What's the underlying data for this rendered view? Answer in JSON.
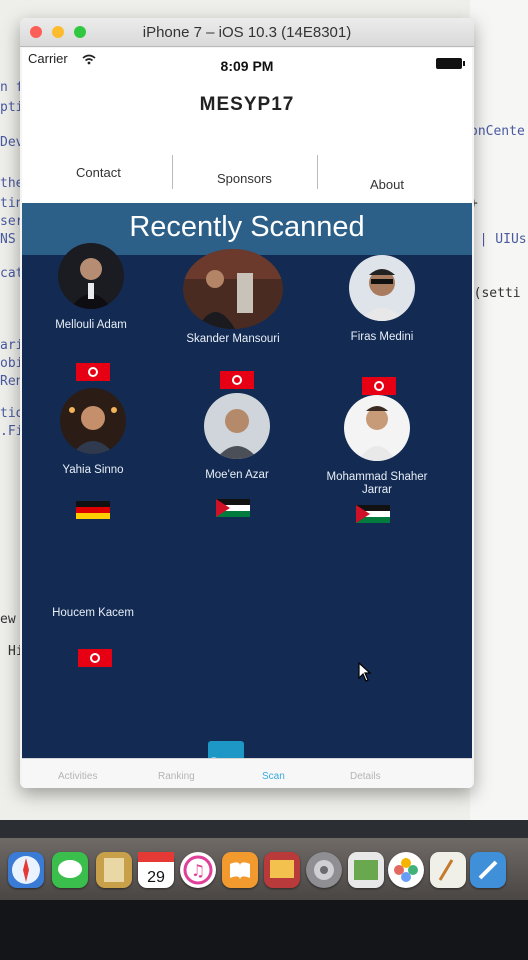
{
  "window": {
    "title": "iPhone 7 – iOS 10.3 (14E8301)"
  },
  "status_bar": {
    "carrier": "Carrier",
    "time": "8:09 PM"
  },
  "nav": {
    "title": "MESYP17"
  },
  "segments": [
    {
      "label": "Contact"
    },
    {
      "label": "Sponsors"
    },
    {
      "label": "About"
    }
  ],
  "section": {
    "title": "Recently Scanned"
  },
  "people": [
    {
      "name": "Mellouli Adam",
      "flag": "Tunisia"
    },
    {
      "name": "Skander Mansouri",
      "flag": "Tunisia"
    },
    {
      "name": "Firas Medini",
      "flag": "Tunisia"
    },
    {
      "name": "Yahia Sinno",
      "flag": "Germany"
    },
    {
      "name": "Moe'en Azar",
      "flag": "Jordan"
    },
    {
      "name": "Mohammad Shaher Jarrar",
      "flag": "Jordan"
    },
    {
      "name": "Houcem Kacem",
      "flag": "Tunisia"
    }
  ],
  "scan_button": {
    "label": "Scan"
  },
  "tabs": [
    {
      "label": "Activities"
    },
    {
      "label": "Ranking"
    },
    {
      "label": "Scan"
    },
    {
      "label": "Details"
    }
  ],
  "colors": {
    "content_bg": "#132b52",
    "header_band": "#2d6088",
    "accent": "#1c97c6",
    "active_tab": "#3aa9df"
  }
}
